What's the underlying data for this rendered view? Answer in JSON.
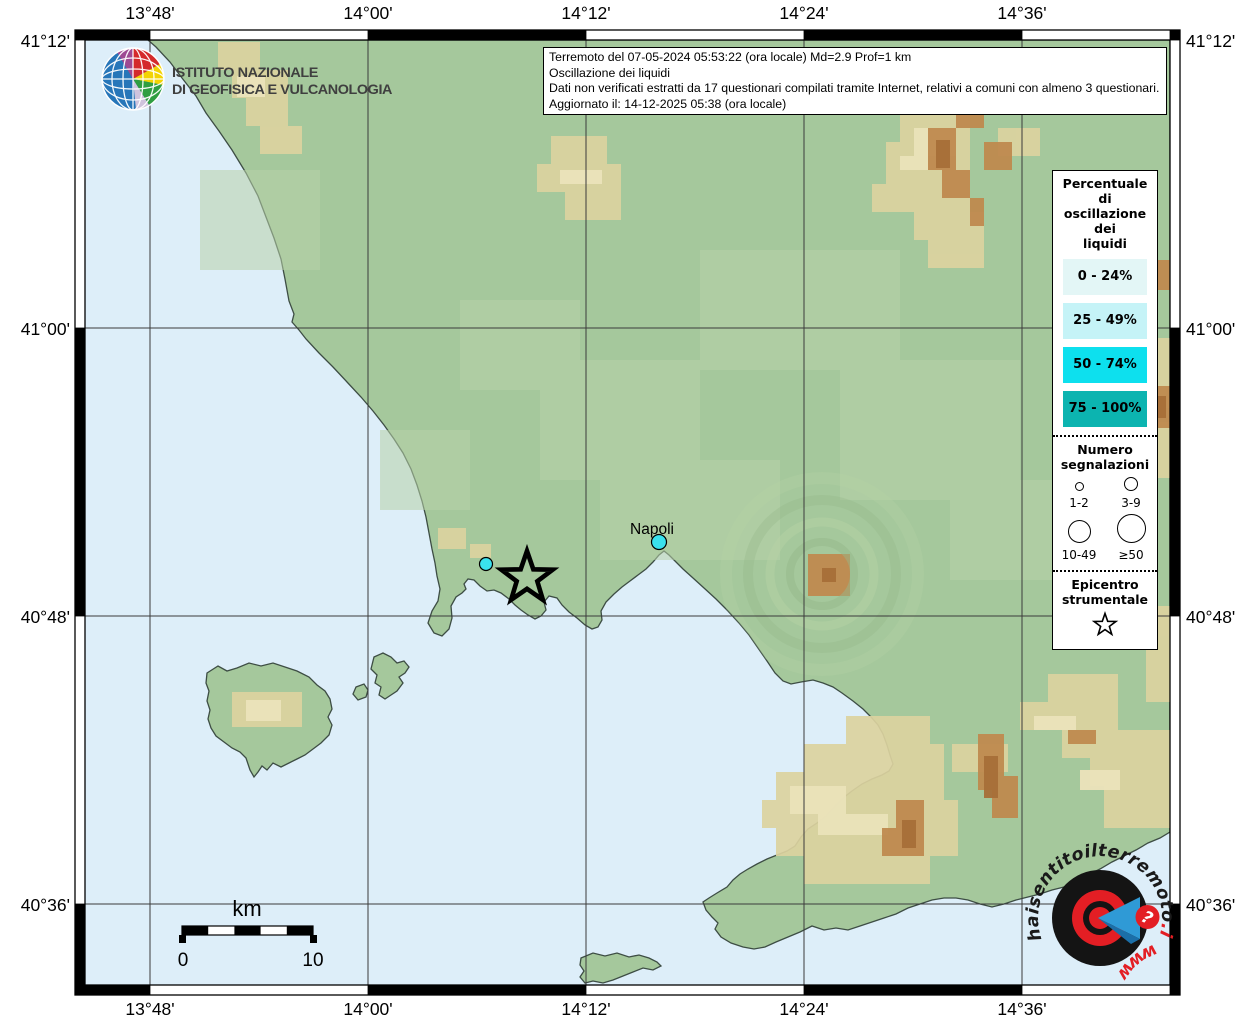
{
  "header": {
    "lines": [
      "Terremoto del 07-05-2024 05:53:22 (ora locale) Md=2.9 Prof=1 km",
      "Oscillazione dei liquidi",
      "Dati non verificati estratti da 17 questionari compilati tramite Internet, relativi a comuni con almeno 3 questionari.",
      "Aggiornato il: 14-12-2025 05:38 (ora locale)"
    ]
  },
  "axes": {
    "top": [
      "13°48'",
      "14°00'",
      "14°12'",
      "14°24'",
      "14°36'"
    ],
    "bottom": [
      "13°48'",
      "14°00'",
      "14°12'",
      "14°24'",
      "14°36'"
    ],
    "left": [
      "41°12'",
      "41°00'",
      "40°48'",
      "40°36'"
    ],
    "right": [
      "41°12'",
      "41°00'",
      "40°48'",
      "40°36'"
    ]
  },
  "map": {
    "city_label": "Napoli",
    "scalebar": {
      "unit": "km",
      "start": "0",
      "end": "10"
    }
  },
  "legend": {
    "percent": {
      "title_lines": [
        "Percentuale",
        "di",
        "oscillazione",
        "dei",
        "liquidi"
      ],
      "classes": [
        {
          "label": "0 - 24%",
          "color": "#e3f6f6"
        },
        {
          "label": "25 - 49%",
          "color": "#c5f3f7"
        },
        {
          "label": "50 - 74%",
          "color": "#0de0ee"
        },
        {
          "label": "75 - 100%",
          "color": "#0cb4b0"
        }
      ]
    },
    "counts": {
      "title_lines": [
        "Numero",
        "segnalazioni"
      ],
      "items": [
        "1-2",
        "3-9",
        "10-49",
        "≥50"
      ]
    },
    "epicenter_lines": [
      "Epicentro",
      "strumentale"
    ]
  },
  "branding": {
    "ingv_lines": [
      "ISTITUTO NAZIONALE",
      "DI GEOFISICA E VULCANOLOGIA"
    ],
    "site": {
      "word1": "haisentito",
      "word2": "il",
      "word3": "terremoto",
      "word4": ".it",
      "word5": "www.",
      "badge": "?"
    }
  },
  "colors": {
    "sea": "#ddeef9",
    "land": "#a5c89c",
    "report_dot": "#3ae2ee",
    "logo_red": "#e31e24",
    "logo_blue": "#2f9ad6"
  }
}
